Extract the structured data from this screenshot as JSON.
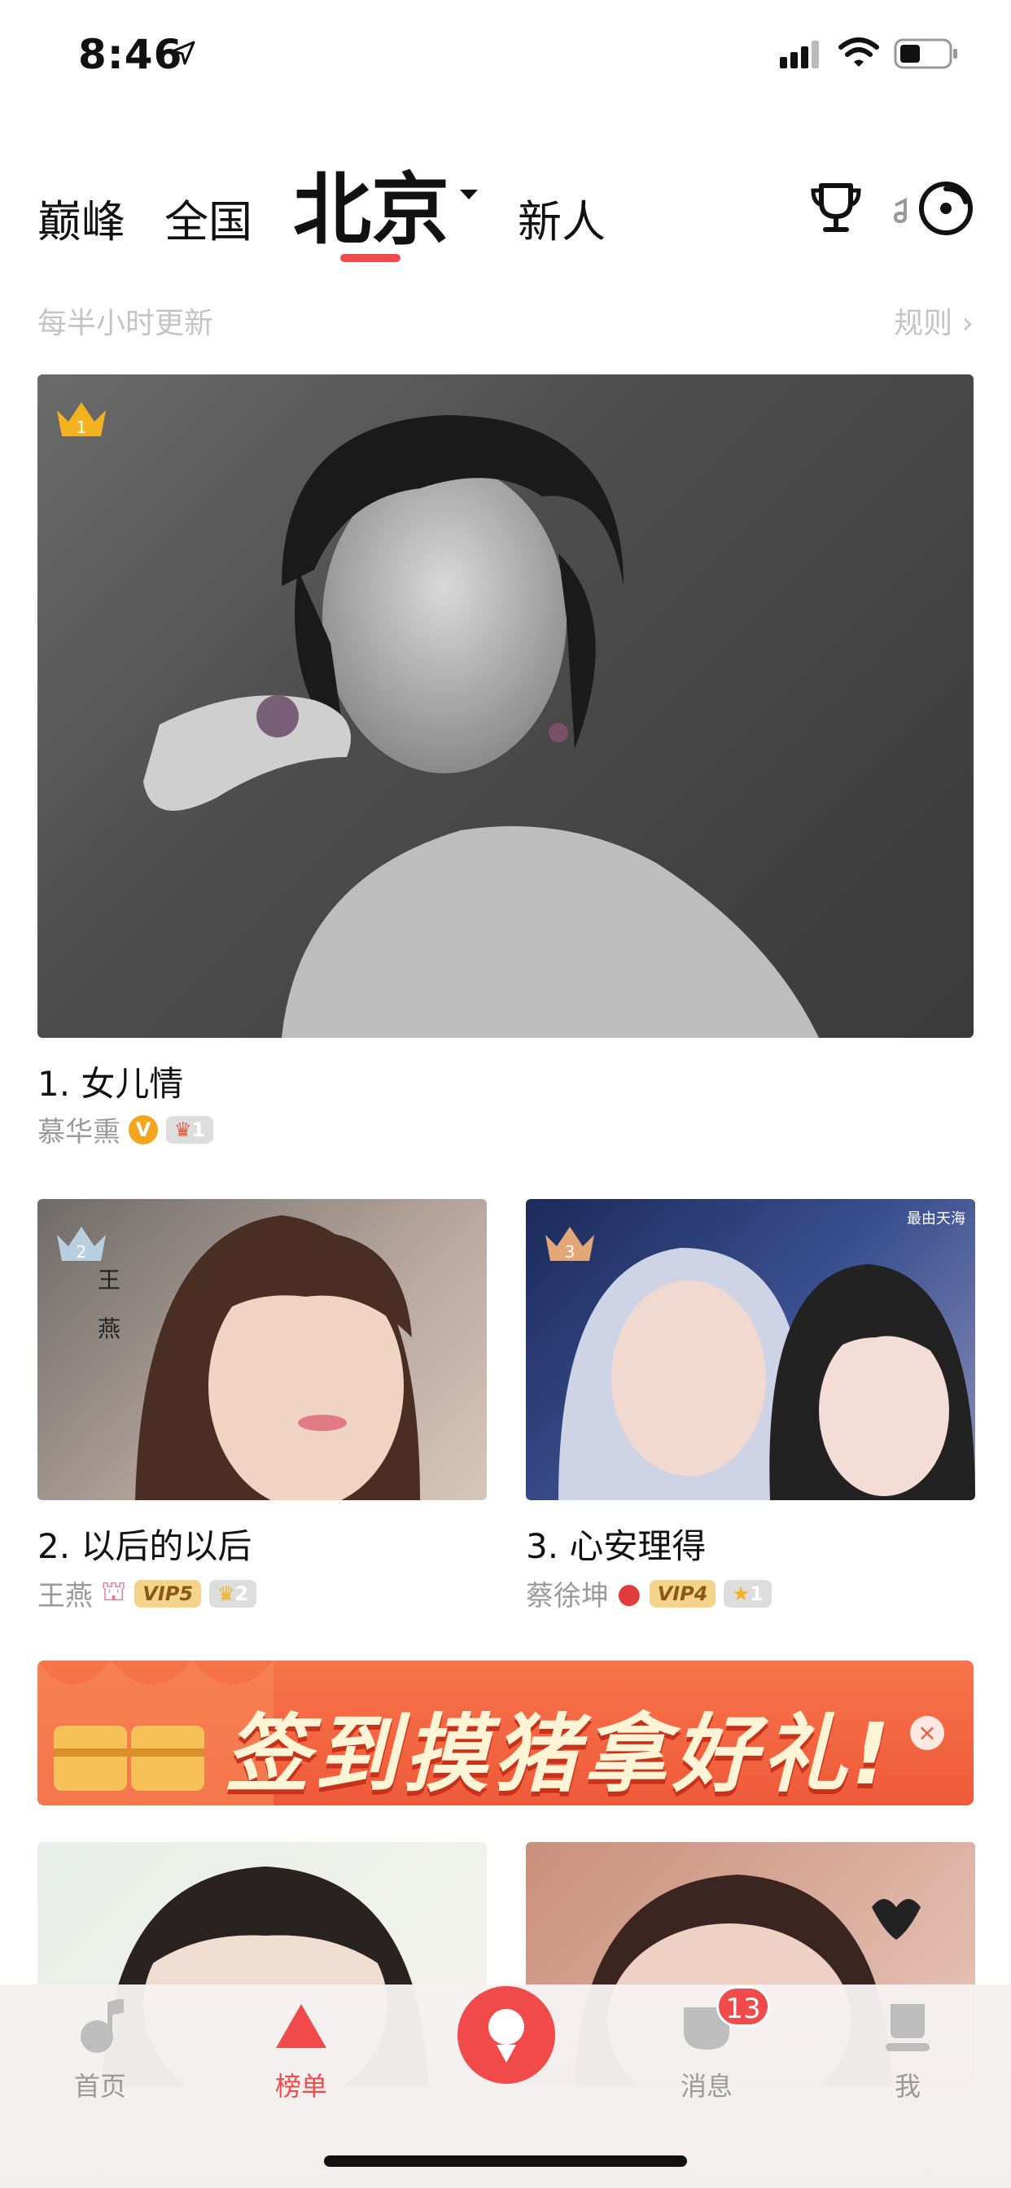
{
  "status_bar": {
    "time": "8:46"
  },
  "top_nav": {
    "tabs": [
      "巅峰",
      "全国",
      "北京",
      "新人"
    ],
    "active_tab": "北京"
  },
  "subheader": {
    "update_note": "每半小时更新",
    "rules_link": "规则 ›"
  },
  "rankings": [
    {
      "rank": "1",
      "title": "1. 女儿情",
      "author": "慕华熏",
      "badge_count": "1"
    },
    {
      "rank": "2",
      "title": "2. 以后的以后",
      "author": "王燕",
      "vip": "VIP5",
      "badge_count": "2"
    },
    {
      "rank": "3",
      "title": "3. 心安理得",
      "author": "蔡徐坤",
      "vip": "VIP4",
      "badge_count": "1"
    }
  ],
  "verified_badge": "V",
  "photo_caption_2": [
    "王",
    "燕"
  ],
  "photo_caption_3": "最由天海",
  "banner": {
    "text": "签到摸猪拿好礼!",
    "close": "×"
  },
  "tabbar": {
    "items": [
      "首页",
      "榜单",
      "",
      "消息",
      "我"
    ],
    "messages_badge": "13"
  },
  "colors": {
    "accent": "#f04a4a",
    "banner": "#ef5a3a",
    "muted_text": "#9a9a9a"
  }
}
